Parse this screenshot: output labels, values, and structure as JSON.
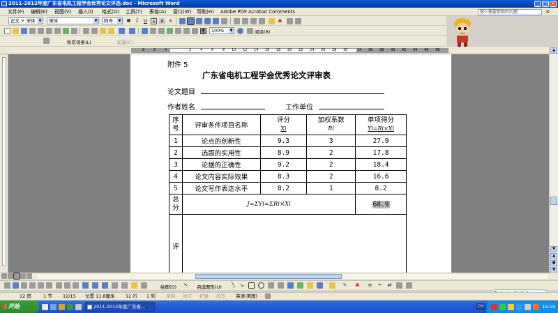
{
  "window": {
    "title": "2011-2012年度广东省电机工程学会优秀论文评选.doc - Microsoft Word"
  },
  "menu": {
    "items": [
      "文件(F)",
      "编辑(E)",
      "视图(V)",
      "插入(I)",
      "格式(O)",
      "工具(T)",
      "表格(A)",
      "窗口(W)",
      "帮助(H)",
      "Adobe PDF",
      "Acrobat Comments"
    ],
    "help_placeholder": "键入需要帮助的问题"
  },
  "format_toolbar": {
    "style": "正文 + 宋体",
    "font": "宋体",
    "size": "四号"
  },
  "standard_toolbar": {
    "zoom": "100%",
    "read_label": "阅读(R)"
  },
  "third_toolbar": {
    "show_label": "所有词条(L)",
    "new_label": "新建(C)"
  },
  "document": {
    "attachment": "附件 5",
    "title": "广东省电机工程学会优秀论文评审表",
    "paper_title_label": "论文题目",
    "author_label": "作者姓名",
    "unit_label": "工作单位",
    "headers": {
      "seq": [
        "序",
        "号"
      ],
      "item": "评审条件项目名称",
      "score": "评分",
      "score_sym": "Xi",
      "weight": "加权系数",
      "weight_sym": "Ri",
      "single": "单项得分",
      "single_formula": "Yi=Ri×Xi"
    },
    "rows": [
      {
        "seq": "1",
        "item": "论点的创新性",
        "score": "9.3",
        "weight": "3",
        "single": "27.9"
      },
      {
        "seq": "2",
        "item": "选题的实用性",
        "score": "8.9",
        "weight": "2",
        "single": "17.8"
      },
      {
        "seq": "3",
        "item": "论据的正确性",
        "score": "9.2",
        "weight": "2",
        "single": "18.4"
      },
      {
        "seq": "4",
        "item": "论文内容实际效果",
        "score": "8.3",
        "weight": "2",
        "single": "16.6"
      },
      {
        "seq": "5",
        "item": "论文写作表达水平",
        "score": "8.2",
        "weight": "1",
        "single": "8.2"
      }
    ],
    "total": {
      "label": [
        "总",
        "分"
      ],
      "formula": "J=ΣYi=ΣRi×Xi",
      "value": "68.9"
    },
    "review_label": "评"
  },
  "drawing_toolbar": {
    "draw_label": "绘图(D)",
    "autoshape_label": "自选图形(U)"
  },
  "status": {
    "page": "12 页",
    "section": "1 节",
    "position": "12/15",
    "at": "位置 11.8厘米",
    "line": "12 行",
    "col": "1 列",
    "rec": "录制",
    "trk": "修订",
    "ext": "扩展",
    "ovr": "改写",
    "lang": "英语(美国)"
  },
  "ime": {
    "text": "中 ♪ ☽ , ☺ ▣ ✎"
  },
  "taskbar": {
    "start": "开始",
    "task_label": "2011-2012年度广东省...",
    "lang_indicator": "CH",
    "clock": "16:19"
  }
}
